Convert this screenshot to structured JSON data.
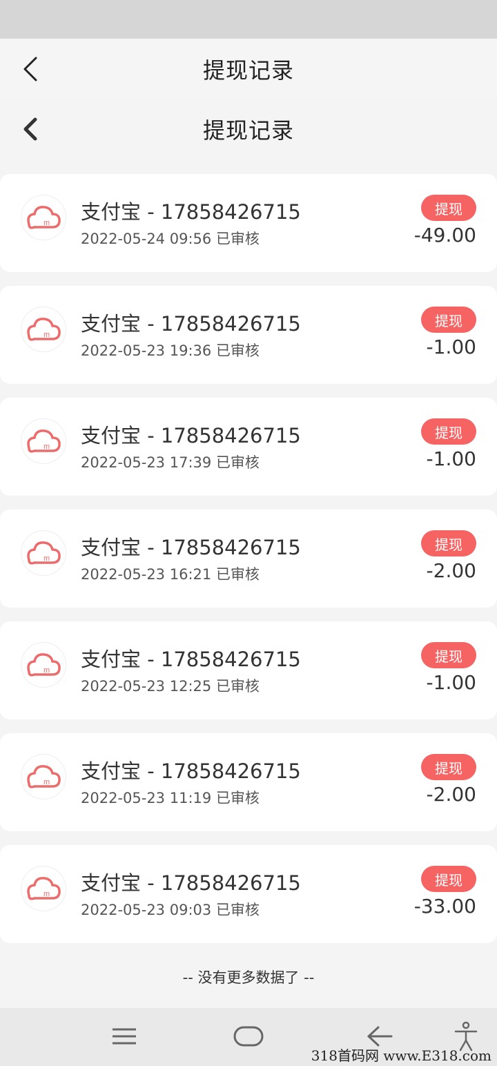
{
  "header": {
    "title_outer": "提现记录",
    "title_inner": "提现记录"
  },
  "records": [
    {
      "account": "支付宝 - 17858426715",
      "datetime": "2022-05-24 09:56 已审核",
      "badge": "提现",
      "amount": "-49.00"
    },
    {
      "account": "支付宝 - 17858426715",
      "datetime": "2022-05-23 19:36 已审核",
      "badge": "提现",
      "amount": "-1.00"
    },
    {
      "account": "支付宝 - 17858426715",
      "datetime": "2022-05-23 17:39 已审核",
      "badge": "提现",
      "amount": "-1.00"
    },
    {
      "account": "支付宝 - 17858426715",
      "datetime": "2022-05-23 16:21 已审核",
      "badge": "提现",
      "amount": "-2.00"
    },
    {
      "account": "支付宝 - 17858426715",
      "datetime": "2022-05-23 12:25 已审核",
      "badge": "提现",
      "amount": "-1.00"
    },
    {
      "account": "支付宝 - 17858426715",
      "datetime": "2022-05-23 11:19 已审核",
      "badge": "提现",
      "amount": "-2.00"
    },
    {
      "account": "支付宝 - 17858426715",
      "datetime": "2022-05-23 09:03 已审核",
      "badge": "提现",
      "amount": "-33.00"
    }
  ],
  "footer": {
    "no_more": "-- 没有更多数据了 --"
  },
  "watermark": "318首码网 www.E318.com",
  "colors": {
    "accent": "#f56363",
    "logo": "#ec6b6b"
  },
  "icons": {
    "logo": "cloud-logo-icon",
    "back": "chevron-left-icon"
  }
}
